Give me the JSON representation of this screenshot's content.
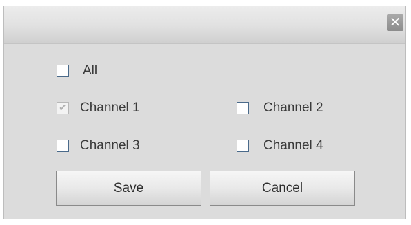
{
  "dialog": {
    "close_icon": "close-icon",
    "close_glyph": "✕"
  },
  "options": {
    "all_label": "All",
    "all_checked": false,
    "channels": [
      {
        "label": "Channel 1",
        "checked": true,
        "disabled": true
      },
      {
        "label": "Channel 2",
        "checked": false,
        "disabled": false
      },
      {
        "label": "Channel 3",
        "checked": false,
        "disabled": false
      },
      {
        "label": "Channel 4",
        "checked": false,
        "disabled": false
      }
    ]
  },
  "actions": {
    "save_label": "Save",
    "cancel_label": "Cancel"
  },
  "colors": {
    "dialog_bg": "#dcdcdc",
    "checkbox_border": "#4a6a8a",
    "text": "#3a3a3a"
  }
}
